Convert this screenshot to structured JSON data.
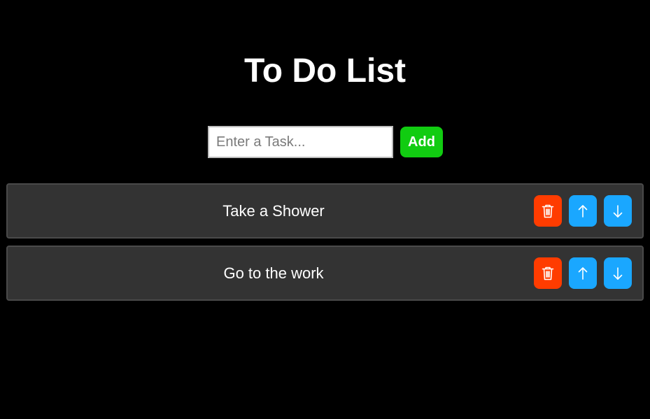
{
  "header": {
    "title": "To Do List"
  },
  "form": {
    "input_value": "",
    "input_placeholder": "Enter a Task...",
    "add_label": "Add"
  },
  "tasks": [
    {
      "text": "Take a Shower"
    },
    {
      "text": "Go to the work"
    }
  ],
  "icons": {
    "delete": "trash-icon",
    "move_up": "arrow-up-icon",
    "move_down": "arrow-down-icon"
  },
  "colors": {
    "background": "#000000",
    "add_button": "#11cc11",
    "delete_button": "#ff3c00",
    "move_button": "#1aa7ff",
    "task_background": "#333333"
  }
}
